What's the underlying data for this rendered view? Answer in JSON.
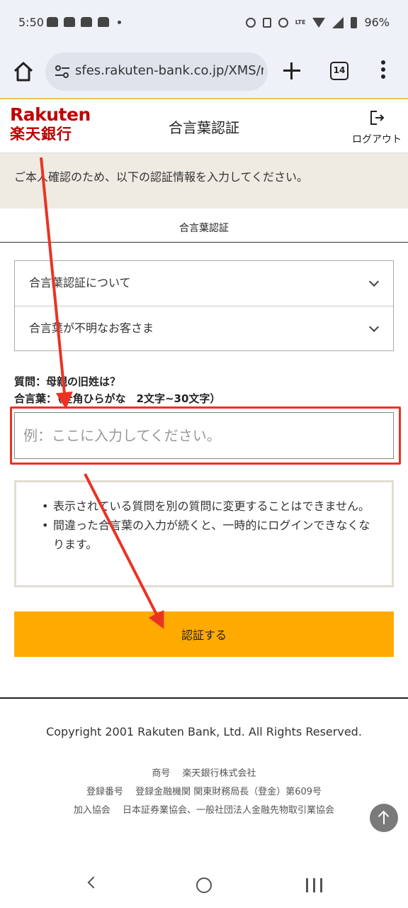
{
  "status_bar": {
    "time": "5:50",
    "battery": "96%",
    "network": "LTE"
  },
  "browser": {
    "url": "sfes.rakuten-bank.co.jp/XMS/rb",
    "tab_count": "14"
  },
  "header": {
    "logo_top": "Rakuten",
    "logo_bottom": "楽天銀行",
    "title": "合言葉認証",
    "logout_label": "ログアウト"
  },
  "info_banner": "ご本人確認のため、以下の認証情報を入力してください。",
  "section_title": "合言葉認証",
  "accordion": [
    {
      "label": "合言葉認証について"
    },
    {
      "label": "合言葉が不明なお客さま"
    }
  ],
  "question": {
    "line1": "質問：母親の旧姓は？",
    "line2": "合言葉：（全角ひらがな　2文字~30文字）"
  },
  "answer_input": {
    "placeholder": "例：ここに入力してください。",
    "value": ""
  },
  "notes": [
    "表示されている質問を別の質問に変更することはできません。",
    "間違った合言葉の入力が続くと、一時的にログインできなくなります。"
  ],
  "submit_label": "認証する",
  "footer": {
    "copyright": "Copyright 2001 Rakuten Bank, Ltd. All Rights Reserved.",
    "company_line": "商号　 楽天銀行株式会社",
    "registration_line": "登録番号　 登録金融機関 関東財務局長（登金）第609号",
    "association_line": "加入協会　 日本証券業協会、一般社団法人金融先物取引業協会"
  },
  "colors": {
    "brand_red": "#bf0000",
    "submit_orange": "#ffaa00",
    "annotation_red": "#ea3323",
    "banner_bg": "#efebe3"
  }
}
